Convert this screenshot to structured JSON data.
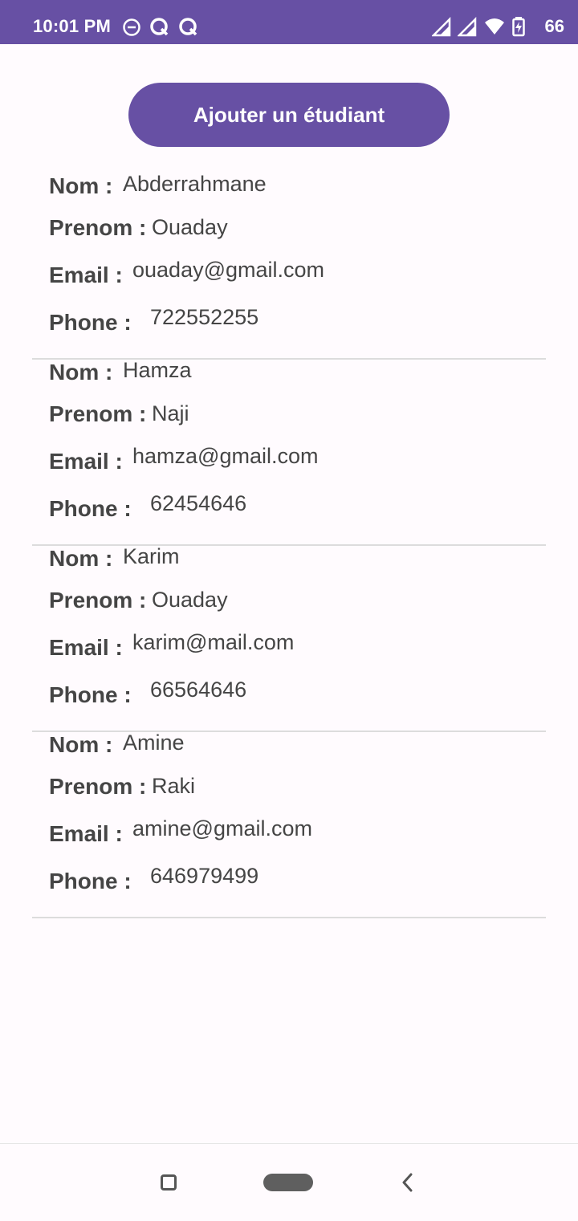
{
  "status_bar": {
    "time": "10:01 PM",
    "battery_level": "66",
    "icons_left": [
      "do-not-disturb-icon",
      "q-app-icon",
      "q-app-icon"
    ],
    "icons_right": [
      "signal-icon",
      "signal-icon",
      "wifi-icon",
      "battery-charging-icon"
    ]
  },
  "actions": {
    "add_student_label": "Ajouter un étudiant"
  },
  "labels": {
    "nom": "Nom :",
    "prenom": "Prenom :",
    "email": "Email :",
    "phone": "Phone :"
  },
  "students": [
    {
      "nom": "Abderrahmane",
      "prenom": "Ouaday",
      "email": "ouaday@gmail.com",
      "phone": "722552255"
    },
    {
      "nom": "Hamza",
      "prenom": "Naji",
      "email": "hamza@gmail.com",
      "phone": "62454646"
    },
    {
      "nom": "Karim",
      "prenom": "Ouaday",
      "email": "karim@mail.com",
      "phone": "66564646"
    },
    {
      "nom": "Amine",
      "prenom": "Raki",
      "email": "amine@gmail.com",
      "phone": "646979499"
    }
  ],
  "colors": {
    "primary": "#6750a4",
    "background": "#fffbfe",
    "text": "#454545",
    "divider": "#dcdcdc"
  },
  "navigation": {
    "icons": [
      "recents-icon",
      "home-pill-icon",
      "back-icon"
    ]
  }
}
